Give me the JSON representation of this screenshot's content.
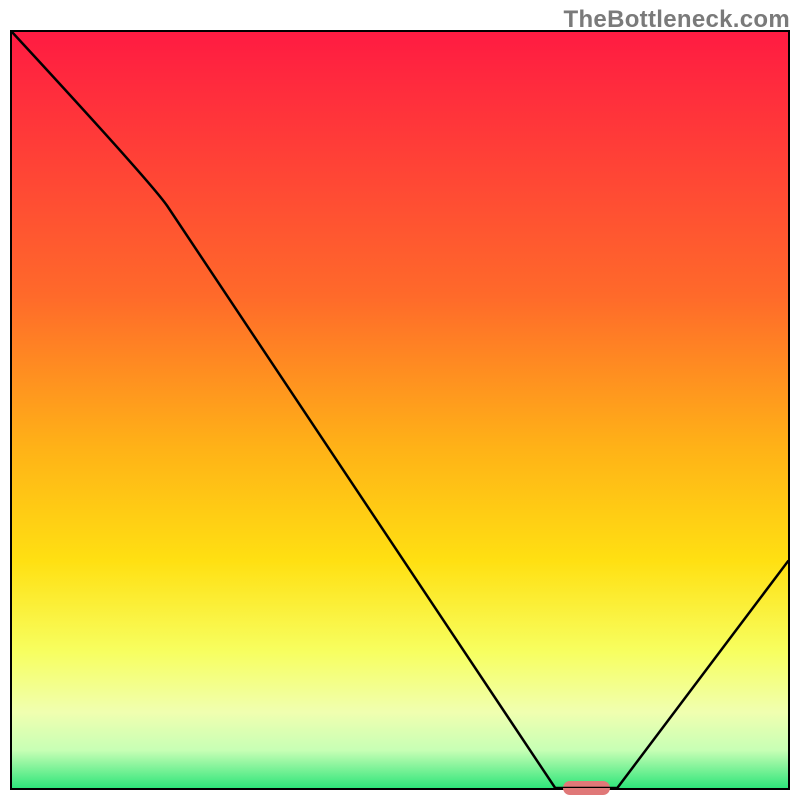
{
  "watermark": "TheBottleneck.com",
  "chart_data": {
    "type": "line",
    "title": "",
    "xlabel": "",
    "ylabel": "",
    "xlim": [
      0,
      100
    ],
    "ylim": [
      0,
      100
    ],
    "grid": false,
    "x": [
      0,
      20,
      70,
      78,
      100
    ],
    "values": [
      100,
      77,
      0,
      0,
      30
    ],
    "marker": {
      "x_center": 74,
      "width_pct": 6
    },
    "gradient_stops": [
      {
        "pos": 0,
        "color": "#ff1b42"
      },
      {
        "pos": 35,
        "color": "#ff6a2a"
      },
      {
        "pos": 55,
        "color": "#ffb217"
      },
      {
        "pos": 70,
        "color": "#ffe012"
      },
      {
        "pos": 82,
        "color": "#f7ff60"
      },
      {
        "pos": 90,
        "color": "#f0ffb0"
      },
      {
        "pos": 95,
        "color": "#c7ffb5"
      },
      {
        "pos": 100,
        "color": "#2fe57a"
      }
    ]
  }
}
